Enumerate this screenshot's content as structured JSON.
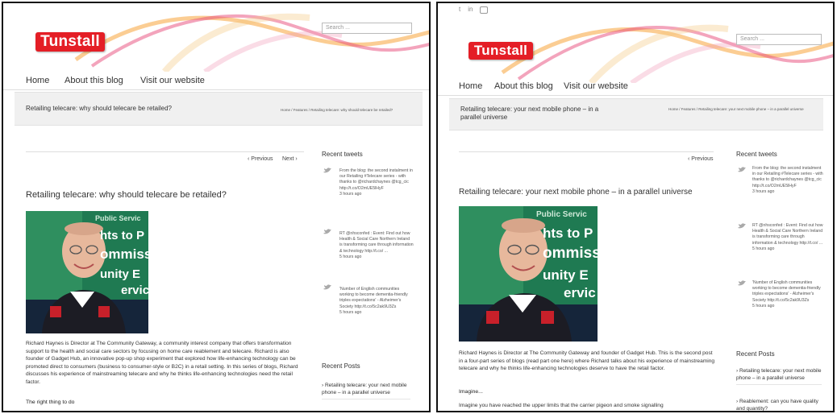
{
  "left": {
    "logo": "Tunstall",
    "search_placeholder": "Search ...",
    "nav": [
      "Home",
      "About this blog",
      "Visit our website"
    ],
    "page_heading": "Retailing telecare: why should telecare be retailed?",
    "breadcrumb": "Home / Features / Retailing telecare: why should telecare be retailed?",
    "prev_label": "‹ Previous",
    "next_label": "Next ›",
    "post_title": "Retailing telecare: why should telecare be retailed?",
    "photo_text": [
      "Public Servic",
      "hts to P",
      "ommiss",
      "unity E",
      "ervic"
    ],
    "body": "Richard Haynes is Director at The Community Gateway, a community interest company that offers transformation support to the health and social care sectors by focusing on home care reablement and telecare. Richard is also founder of Gadget Hub, an innovative pop-up shop experiment that explored how life-enhancing technology can be promoted direct to consumers (business to consumer-style or B2C) in a retail setting. In this series of blogs, Richard discusses his experience of mainstreaming telecare and why he thinks life-enhancing technologies need the retail factor.",
    "subhead": "The right thing to do",
    "sidebar": {
      "tweets_heading": "Recent tweets",
      "tweets": [
        {
          "text": "From the blog: the second instalment in our Retailing #Telecare series - with thanks to @richardchaynes @tcg_cic http://t.co/O2mUE5lHyF",
          "time": "3 hours ago"
        },
        {
          "text": "RT @nhsconfed : Event: Find out how Health & Social Care Northern Ireland is transforming care through information & technology http://t.co/ ...",
          "time": "5 hours ago"
        },
        {
          "text": "'Number of English communities working to become dementia-friendly triples expectations' - Alzheimer's Society http://t.co/5c2ak9U3Zs",
          "time": "5 hours ago"
        }
      ],
      "posts_heading": "Recent Posts",
      "posts": [
        "› Retailing telecare: your next mobile phone – in a parallel universe"
      ]
    }
  },
  "right": {
    "social": [
      "t",
      "in"
    ],
    "logo": "Tunstall",
    "search_placeholder": "Search ...",
    "nav": [
      "Home",
      "About this blog",
      "Visit our website"
    ],
    "page_heading": "Retailing telecare: your next mobile phone – in a parallel universe",
    "breadcrumb": "Home / Features / Retailing telecare: your next mobile phone – in a parallel universe",
    "prev_label": "‹ Previous",
    "post_title": "Retailing telecare: your next mobile phone – in a parallel universe",
    "photo_text": [
      "Public Servic",
      "hts to P",
      "ommiss",
      "unity E",
      "ervic"
    ],
    "body": "Richard Haynes is Director at The Community Gateway and founder of Gadget Hub. This is the second post in a four-part series of blogs (read part one here) where Richard talks about his experience of mainstreaming telecare and why he thinks life-enhancing technologies deserve to have the retail factor.",
    "subhead": "Imagine...",
    "body2": "Imagine you have reached the upper limits that the carrier pigeon and smoke signalling",
    "sidebar": {
      "tweets_heading": "Recent tweets",
      "tweets": [
        {
          "text": "From the blog: the second instalment in our Retailing #Telecare series - with thanks to @richardchaynes @tcg_cic http://t.co/O2mUE5lHyF",
          "time": "3 hours ago"
        },
        {
          "text": "RT @nhsconfed : Event: Find out how Health & Social Care Northern Ireland is transforming care through information & technology http://t.co/ ...",
          "time": "5 hours ago"
        },
        {
          "text": "'Number of English communities working to become dementia-friendly triples expectations' - Alzheimer's Society http://t.co/5c2ak9U3Zs",
          "time": "5 hours ago"
        }
      ],
      "posts_heading": "Recent Posts",
      "posts": [
        "› Retailing telecare: your next mobile phone – in a parallel universe",
        "› Reablement: can you have quality and quantity?"
      ]
    }
  },
  "colors": {
    "brand_red": "#e41e26",
    "swoosh_orange": "#f7a43a",
    "swoosh_pink": "#e84a7a",
    "title_bar": "#f0f0f0"
  },
  "icons": [
    "twitter-bird-icon",
    "youtube-icon",
    "linkedin-icon"
  ]
}
